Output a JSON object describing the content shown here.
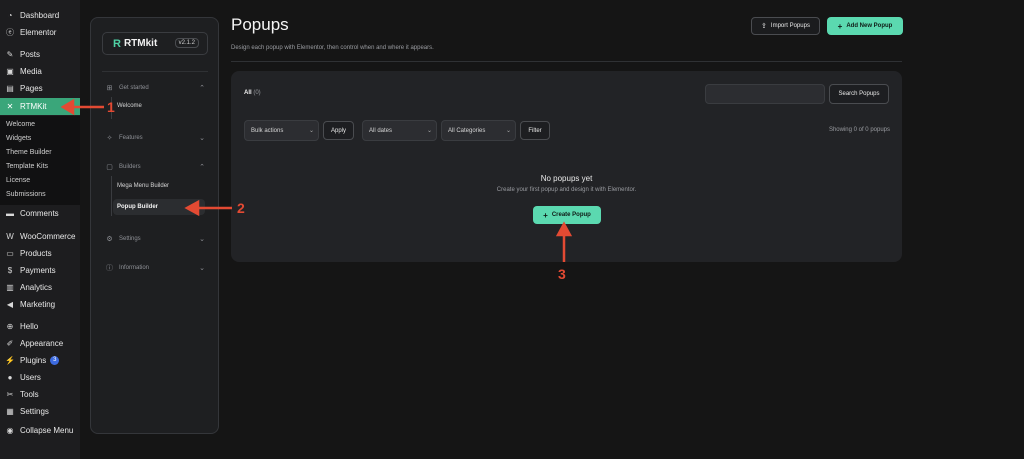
{
  "wp_menu": {
    "items": [
      {
        "label": "Dashboard",
        "icon": "dashboard-icon"
      },
      {
        "label": "Elementor",
        "icon": "elementor-icon"
      },
      {
        "label": "Posts",
        "icon": "pin-icon"
      },
      {
        "label": "Media",
        "icon": "media-icon"
      },
      {
        "label": "Pages",
        "icon": "pages-icon"
      },
      {
        "label": "RTMKit",
        "icon": "rtmkit-icon",
        "active": true
      },
      {
        "label": "Comments",
        "icon": "comment-icon"
      },
      {
        "label": "WooCommerce",
        "icon": "woocommerce-icon"
      },
      {
        "label": "Products",
        "icon": "products-icon"
      },
      {
        "label": "Payments",
        "icon": "payments-icon"
      },
      {
        "label": "Analytics",
        "icon": "analytics-icon"
      },
      {
        "label": "Marketing",
        "icon": "megaphone-icon"
      },
      {
        "label": "Hello",
        "icon": "hello-icon"
      },
      {
        "label": "Appearance",
        "icon": "brush-icon"
      },
      {
        "label": "Plugins",
        "icon": "plugin-icon",
        "badge": "3"
      },
      {
        "label": "Users",
        "icon": "user-icon"
      },
      {
        "label": "Tools",
        "icon": "wrench-icon"
      },
      {
        "label": "Settings",
        "icon": "settings-icon"
      },
      {
        "label": "Collapse Menu",
        "icon": "collapse-icon"
      }
    ],
    "submenu": [
      "Welcome",
      "Widgets",
      "Theme Builder",
      "Template Kits",
      "License",
      "Submissions"
    ]
  },
  "plugin_panel": {
    "logo_mark": "R",
    "logo_text": "RTMkit",
    "version": "v2.1.2",
    "sections": {
      "get_started": "Get started",
      "welcome": "Welcome",
      "features": "Features",
      "builders": "Builders",
      "mega_menu": "Mega Menu Builder",
      "popup_builder": "Popup Builder",
      "settings": "Settings",
      "information": "Information"
    }
  },
  "page": {
    "title": "Popups",
    "subtitle": "Design each popup with Elementor, then control when and where it appears.",
    "import_label": "Import Popups",
    "add_new_label": "Add New Popup"
  },
  "list": {
    "tab_all": "All",
    "tab_all_count": "(0)",
    "search_button": "Search Popups",
    "bulk_actions": "Bulk actions",
    "apply": "Apply",
    "all_dates": "All dates",
    "all_categories": "All Categories",
    "filter": "Filter",
    "showing": "Showing 0 of 0 popups",
    "empty_title": "No popups yet",
    "empty_sub": "Create your first popup and design it with Elementor.",
    "create_label": "Create Popup"
  },
  "annotations": [
    "1",
    "2",
    "3"
  ],
  "colors": {
    "accent": "#5bd9b0",
    "annotation": "#e34a33",
    "wp_active": "#3aa67a"
  }
}
